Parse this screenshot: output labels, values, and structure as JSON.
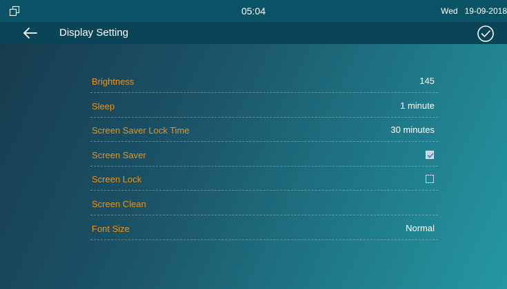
{
  "status_bar": {
    "icon": "window-restore-icon",
    "time": "05:04",
    "day": "Wed",
    "date": "19-09-2018"
  },
  "header": {
    "back_icon": "arrow-left-icon",
    "title": "Display Setting",
    "confirm_icon": "check-circle-icon"
  },
  "settings": [
    {
      "label": "Brightness",
      "value": "145"
    },
    {
      "label": "Sleep",
      "value": "1 minute"
    },
    {
      "label": "Screen Saver Lock Time",
      "value": "30 minutes"
    },
    {
      "label": "Screen Saver",
      "checked": true
    },
    {
      "label": "Screen Lock",
      "checked": false
    },
    {
      "label": "Screen Clean"
    },
    {
      "label": "Font Size",
      "value": "Normal"
    }
  ],
  "colors": {
    "status_bar": "#0a5366",
    "title_bar": "#0a4557",
    "label": "#e7951b",
    "value": "#ffffff"
  }
}
